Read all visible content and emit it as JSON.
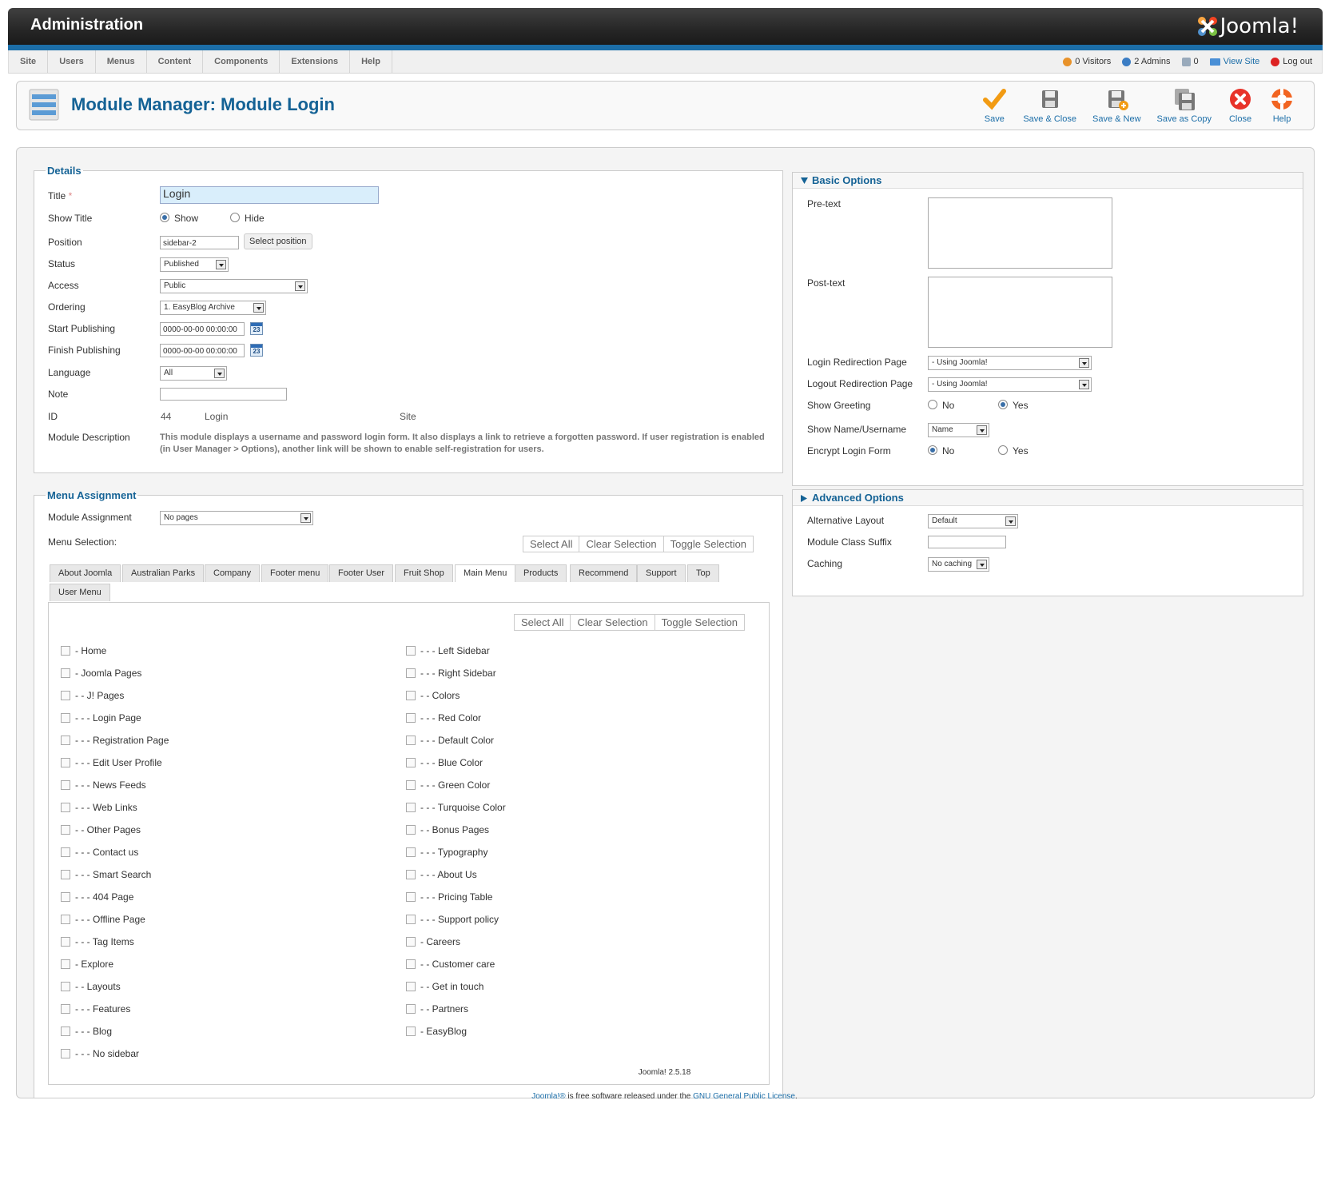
{
  "header": {
    "title": "Administration",
    "logo_text": "Joomla!"
  },
  "menubar": {
    "items": [
      "Site",
      "Users",
      "Menus",
      "Content",
      "Components",
      "Extensions",
      "Help"
    ],
    "status": {
      "visitors": "0 Visitors",
      "admins": "2 Admins",
      "messages": "0",
      "view_site": "View Site",
      "logout": "Log out"
    }
  },
  "page_title": "Module Manager: Module Login",
  "toolbar": {
    "save": "Save",
    "save_close": "Save & Close",
    "save_new": "Save & New",
    "save_copy": "Save as Copy",
    "close": "Close",
    "help": "Help"
  },
  "details": {
    "legend": "Details",
    "title_label": "Title",
    "required_mark": "*",
    "title_value": "Login",
    "show_title_label": "Show Title",
    "show": "Show",
    "hide": "Hide",
    "position_label": "Position",
    "position_value": "sidebar-2",
    "select_position": "Select position",
    "status_label": "Status",
    "status_value": "Published",
    "access_label": "Access",
    "access_value": "Public",
    "ordering_label": "Ordering",
    "ordering_value": "1. EasyBlog Archive",
    "start_label": "Start Publishing",
    "start_value": "0000-00-00 00:00:00",
    "finish_label": "Finish Publishing",
    "finish_value": "0000-00-00 00:00:00",
    "calendar_day": "23",
    "language_label": "Language",
    "language_value": "All",
    "note_label": "Note",
    "note_value": "",
    "id_label": "ID",
    "id_value": "44",
    "id_module": "Login",
    "id_client": "Site",
    "desc_label": "Module Description",
    "desc_value": "This module displays a username and password login form. It also displays a link to retrieve a forgotten password. If user registration is enabled (in User Manager > Options), another link will be shown to enable self-registration for users."
  },
  "menu_assignment": {
    "legend": "Menu Assignment",
    "assignment_label": "Module Assignment",
    "assignment_value": "No pages",
    "selection_label": "Menu Selection:",
    "select_all": "Select All",
    "clear_selection": "Clear Selection",
    "toggle_selection": "Toggle Selection",
    "tabs": [
      "About Joomla",
      "Australian Parks",
      "Company",
      "Footer menu",
      "Footer User",
      "Fruit Shop",
      "Main Menu",
      "Products",
      "Recommend",
      "Support",
      "Top",
      "User Menu"
    ],
    "active_tab": "Main Menu",
    "left_items": [
      "- Home",
      "- Joomla Pages",
      "- - J! Pages",
      "- - - Login Page",
      "- - - Registration Page",
      "- - - Edit User Profile",
      "- - - News Feeds",
      "- - - Web Links",
      "- - Other Pages",
      "- - - Contact us",
      "- - - Smart Search",
      "- - - 404 Page",
      "- - - Offline Page",
      "- - - Tag Items",
      "- Explore",
      "- - Layouts",
      "- - - Features",
      "- - - Blog",
      "- - - No sidebar"
    ],
    "right_items": [
      "- - - Left Sidebar",
      "- - - Right Sidebar",
      "- - Colors",
      "- - - Red Color",
      "- - - Default Color",
      "- - - Blue Color",
      "- - - Green Color",
      "- - - Turquoise Color",
      "- - Bonus Pages",
      "- - - Typography",
      "- - - About Us",
      "- - - Pricing Table",
      "- - - Support policy",
      "- Careers",
      "- - Customer care",
      "- - Get in touch",
      "- - Partners",
      "- EasyBlog"
    ]
  },
  "basic_options": {
    "title": "Basic Options",
    "pretext_label": "Pre-text",
    "posttext_label": "Post-text",
    "login_redirect_label": "Login Redirection Page",
    "login_redirect_value": "- Using Joomla!",
    "logout_redirect_label": "Logout Redirection Page",
    "logout_redirect_value": "- Using Joomla!",
    "greeting_label": "Show Greeting",
    "no": "No",
    "yes": "Yes",
    "name_label": "Show Name/Username",
    "name_value": "Name",
    "encrypt_label": "Encrypt Login Form"
  },
  "advanced_options": {
    "title": "Advanced Options",
    "layout_label": "Alternative Layout",
    "layout_value": "Default",
    "suffix_label": "Module Class Suffix",
    "caching_label": "Caching",
    "caching_value": "No caching"
  },
  "footer": {
    "version": "Joomla! 2.5.18",
    "license_pre": "Joomla!®",
    "license_mid": " is free software released under the ",
    "license_link": "GNU General Public License",
    "license_end": "."
  }
}
